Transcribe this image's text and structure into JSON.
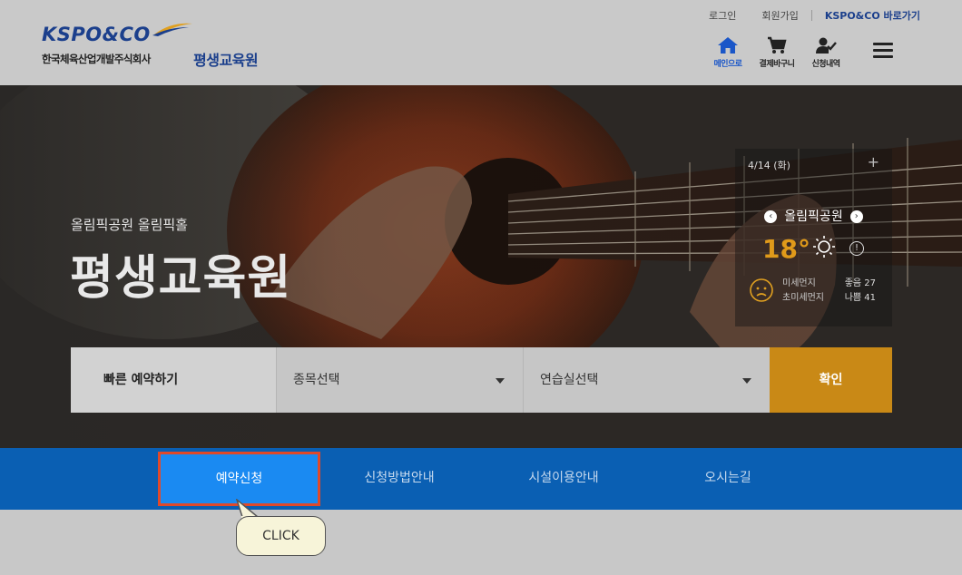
{
  "header": {
    "logo_text": "KSPO&CO",
    "logo_subtitle": "한국체육산업개발주식회사",
    "org_name": "평생교육원",
    "top_links": {
      "login": "로그인",
      "signup": "회원가입",
      "shortcut": "KSPO&CO 바로가기"
    },
    "quick_nav": [
      {
        "label": "메인으로",
        "icon": "home-icon"
      },
      {
        "label": "결제바구니",
        "icon": "cart-icon"
      },
      {
        "label": "신청내역",
        "icon": "user-check-icon"
      }
    ],
    "menu_icon": "hamburger-icon"
  },
  "hero": {
    "subtitle": "올림픽공원 올림픽홀",
    "title": "평생교육원"
  },
  "weather": {
    "date": "4/14 (화)",
    "location": "올림픽공원",
    "prev": "‹",
    "next": "›",
    "temperature": "18°",
    "condition_icon": "sun-icon",
    "fine_dust_label": "미세먼지",
    "ultra_fine_dust_label": "초미세먼지",
    "fine_dust_value": "좋음 27",
    "ultra_fine_dust_value": "나쁨 41",
    "accent_color": "#e09a1a"
  },
  "quick_reserve": {
    "label": "빠른 예약하기",
    "sport_select": "종목선택",
    "room_select": "연습실선택",
    "confirm": "확인",
    "confirm_color": "#c98916"
  },
  "tabs": [
    {
      "label": "예약신청",
      "active": true
    },
    {
      "label": "신청방법안내",
      "active": false
    },
    {
      "label": "시설이용안내",
      "active": false
    },
    {
      "label": "오시는길",
      "active": false
    }
  ],
  "tabbar_color": "#0a5fb3",
  "callout": {
    "text": "CLICK"
  }
}
